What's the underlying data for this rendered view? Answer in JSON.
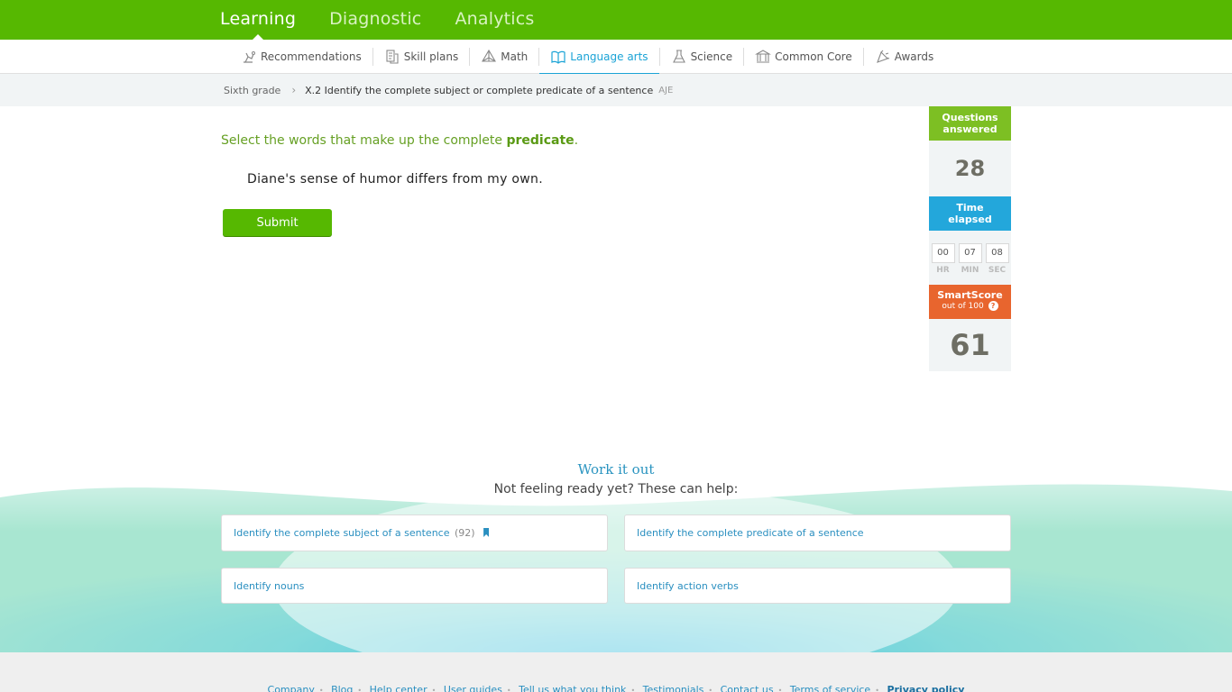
{
  "topnav": {
    "items": [
      {
        "label": "Learning"
      },
      {
        "label": "Diagnostic"
      },
      {
        "label": "Analytics"
      }
    ]
  },
  "subnav": {
    "items": [
      {
        "label": "Recommendations",
        "icon": "recommendations-icon"
      },
      {
        "label": "Skill plans",
        "icon": "skill-plans-icon"
      },
      {
        "label": "Math",
        "icon": "math-icon"
      },
      {
        "label": "Language arts",
        "icon": "language-arts-icon"
      },
      {
        "label": "Science",
        "icon": "science-icon"
      },
      {
        "label": "Common Core",
        "icon": "common-core-icon"
      },
      {
        "label": "Awards",
        "icon": "awards-icon"
      }
    ]
  },
  "breadcrumb": {
    "grade": "Sixth grade",
    "skill": "X.2 Identify the complete subject or complete predicate of a sentence",
    "code": "AJE"
  },
  "question": {
    "prompt_prefix": "Select the words that make up the complete",
    "prompt_keyword": "predicate",
    "prompt_suffix": ".",
    "sentence": "Diane's sense of humor differs from my own.",
    "submit_label": "Submit"
  },
  "stats": {
    "answered_label_1": "Questions",
    "answered_label_2": "answered",
    "answered_value": "28",
    "time_label_1": "Time",
    "time_label_2": "elapsed",
    "time_hr": "00",
    "time_min": "07",
    "time_sec": "08",
    "hr_label": "HR",
    "min_label": "MIN",
    "sec_label": "SEC",
    "smartscore_label": "SmartScore",
    "smartscore_sub": "out of 100",
    "smartscore_help": "?",
    "smartscore_value": "61"
  },
  "work_it_out": {
    "title": "Work it out",
    "subtitle": "Not feeling ready yet? These can help:",
    "cards": [
      {
        "label": "Identify the complete subject of a sentence",
        "count": "(92)"
      },
      {
        "label": "Identify the complete predicate of a sentence"
      },
      {
        "label": "Identify nouns"
      },
      {
        "label": "Identify action verbs"
      }
    ]
  },
  "footer": {
    "links": [
      "Company",
      "Blog",
      "Help center",
      "User guides",
      "Tell us what you think",
      "Testimonials",
      "Contact us",
      "Terms of service",
      "Privacy policy"
    ]
  },
  "colors": {
    "brand_green": "#56b801",
    "accent_blue": "#1aa3d6",
    "smartscore_orange": "#e8652e"
  }
}
